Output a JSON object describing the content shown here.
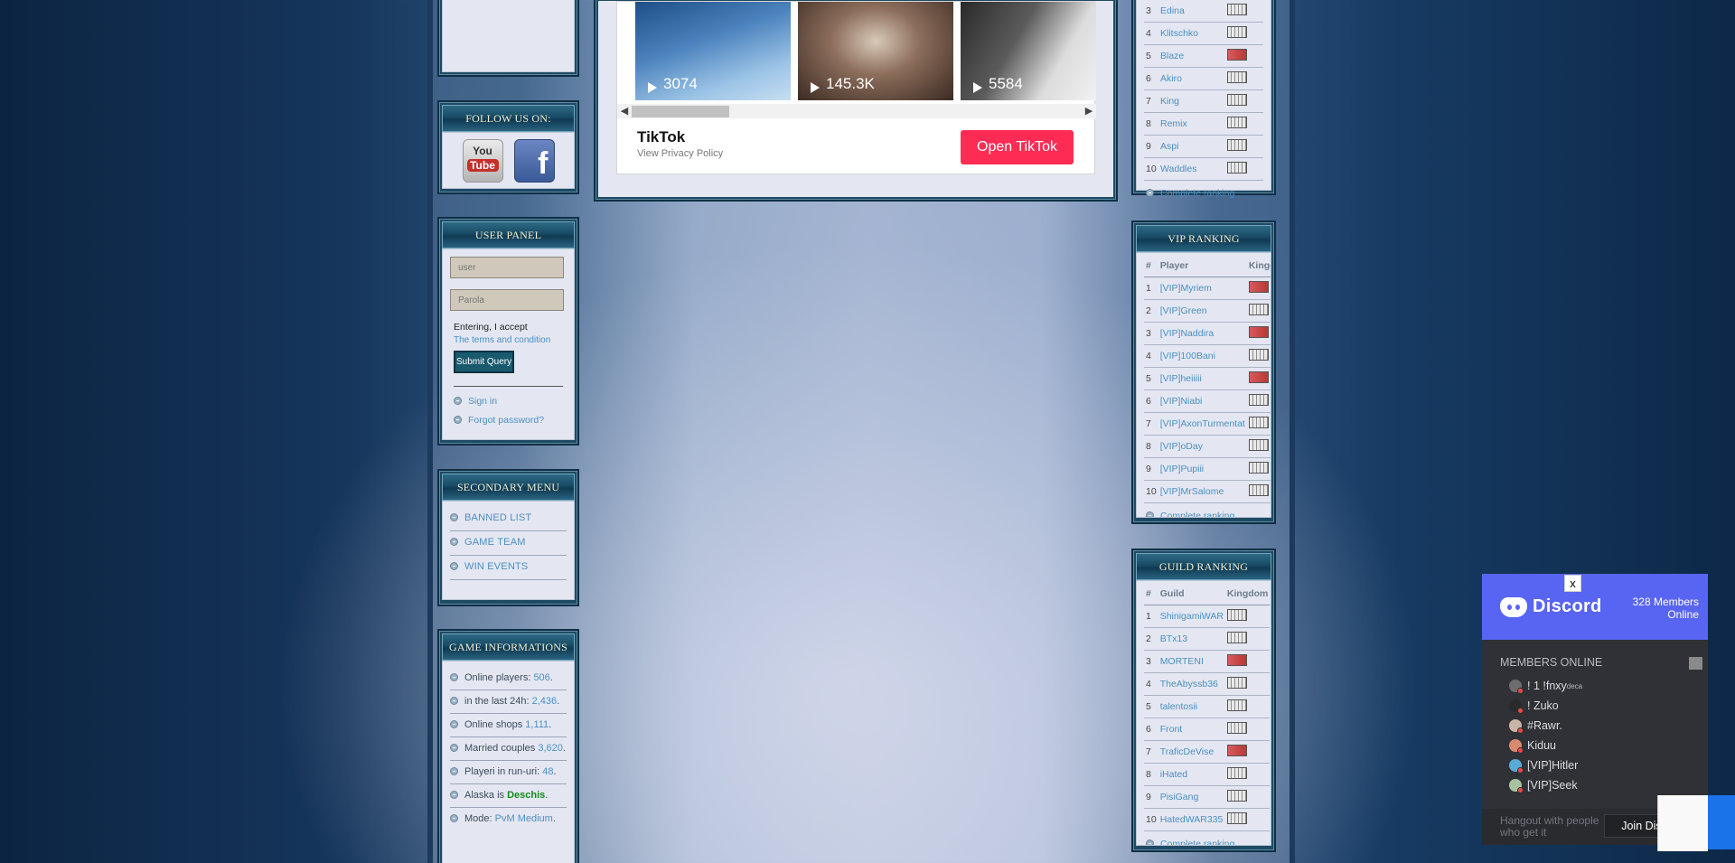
{
  "follow": {
    "title": "FOLLOW US ON:",
    "youtube_top": "You",
    "youtube_bottom": "Tube",
    "facebook": "f"
  },
  "user_panel": {
    "title": "USER PANEL",
    "user_placeholder": "user",
    "pass_placeholder": "Parola",
    "accept_text": "Entering, I accept",
    "terms_link": "The terms and condition",
    "submit": "Submit Query",
    "sign_in": "Sign in",
    "forgot": "Forgot password?"
  },
  "secondary_menu": {
    "title": "SECONDARY MENU",
    "items": [
      "BANNED LIST",
      "GAME TEAM",
      "WIN EVENTS"
    ]
  },
  "game_info": {
    "title": "GAME INFORMATIONS",
    "items": [
      {
        "label": "Online players: ",
        "value": "506",
        "suffix": "."
      },
      {
        "label": "in the last 24h: ",
        "value": "2,436",
        "suffix": "."
      },
      {
        "label": "Online shops ",
        "value": "1,111",
        "suffix": "."
      },
      {
        "label": "Married couples ",
        "value": "3,620",
        "suffix": "."
      },
      {
        "label": "Playeri in run-uri: ",
        "value": "48",
        "suffix": "."
      },
      {
        "label": "Alaska is ",
        "value": "Deschis",
        "suffix": "."
      },
      {
        "label": "Mode: ",
        "value": "PvM Medium",
        "suffix": "."
      }
    ]
  },
  "tiktok": {
    "views": [
      "3074",
      "145.3K",
      "5584"
    ],
    "title": "TikTok",
    "privacy": "View Privacy Policy",
    "open_button": "Open TikTok"
  },
  "top_ranking": {
    "rows": [
      {
        "n": "3",
        "name": "Edina",
        "kingdom": "grey"
      },
      {
        "n": "4",
        "name": "Klitschko",
        "kingdom": "grey"
      },
      {
        "n": "5",
        "name": "Blaze",
        "kingdom": "red"
      },
      {
        "n": "6",
        "name": "Akiro",
        "kingdom": "grey"
      },
      {
        "n": "7",
        "name": "King",
        "kingdom": "grey"
      },
      {
        "n": "8",
        "name": "Remix",
        "kingdom": "grey"
      },
      {
        "n": "9",
        "name": "Aspi",
        "kingdom": "grey"
      },
      {
        "n": "10",
        "name": "Waddles",
        "kingdom": "grey"
      }
    ],
    "complete": "Complete ranking"
  },
  "vip_ranking": {
    "title": "VIP RANKING",
    "headers": [
      "#",
      "Player",
      "Kingdom"
    ],
    "rows": [
      {
        "n": "1",
        "name": "[VIP]Myriem",
        "kingdom": "red"
      },
      {
        "n": "2",
        "name": "[VIP]Green",
        "kingdom": "grey"
      },
      {
        "n": "3",
        "name": "[VIP]Naddira",
        "kingdom": "red"
      },
      {
        "n": "4",
        "name": "[VIP]100Bani",
        "kingdom": "grey"
      },
      {
        "n": "5",
        "name": "[VIP]heiiiii",
        "kingdom": "red"
      },
      {
        "n": "6",
        "name": "[VIP]Niabi",
        "kingdom": "grey"
      },
      {
        "n": "7",
        "name": "[VIP]AxonTurmentat",
        "kingdom": "grey"
      },
      {
        "n": "8",
        "name": "[VIP]oDay",
        "kingdom": "grey"
      },
      {
        "n": "9",
        "name": "[VIP]Pupiii",
        "kingdom": "grey"
      },
      {
        "n": "10",
        "name": "[VIP]MrSalome",
        "kingdom": "grey"
      }
    ],
    "complete": "Complete ranking"
  },
  "guild_ranking": {
    "title": "GUILD RANKING",
    "headers": [
      "#",
      "Guild",
      "Kingdom"
    ],
    "rows": [
      {
        "n": "1",
        "name": "ShinigamiWAR",
        "kingdom": "grey"
      },
      {
        "n": "2",
        "name": "BTx13",
        "kingdom": "grey"
      },
      {
        "n": "3",
        "name": "MORTENI",
        "kingdom": "red"
      },
      {
        "n": "4",
        "name": "TheAbyssb36",
        "kingdom": "grey"
      },
      {
        "n": "5",
        "name": "talentosii",
        "kingdom": "grey"
      },
      {
        "n": "6",
        "name": "Front",
        "kingdom": "grey"
      },
      {
        "n": "7",
        "name": "TraficDeVise",
        "kingdom": "red"
      },
      {
        "n": "8",
        "name": "iHated",
        "kingdom": "grey"
      },
      {
        "n": "9",
        "name": "PisiGang",
        "kingdom": "grey"
      },
      {
        "n": "10",
        "name": "HatedWAR335",
        "kingdom": "grey"
      }
    ],
    "complete": "Complete ranking"
  },
  "discord": {
    "brand": "Discord",
    "count_line1": "328 Members",
    "count_line2": "Online",
    "close": "x",
    "members_title": "MEMBERS ONLINE",
    "members": [
      "! 1 !fnxy",
      "! Zuko",
      "#Rawr.",
      "Kiduu",
      "[VIP]Hitler",
      "[VIP]Seek"
    ],
    "first_member_sup": "deca",
    "hangout": "Hangout with people who get it",
    "join": "Join Discord"
  },
  "colors": {
    "link": "#4b8fc0",
    "tiktok": "#fe2c55",
    "discord": "#5865f2",
    "green": "#148a1e"
  }
}
